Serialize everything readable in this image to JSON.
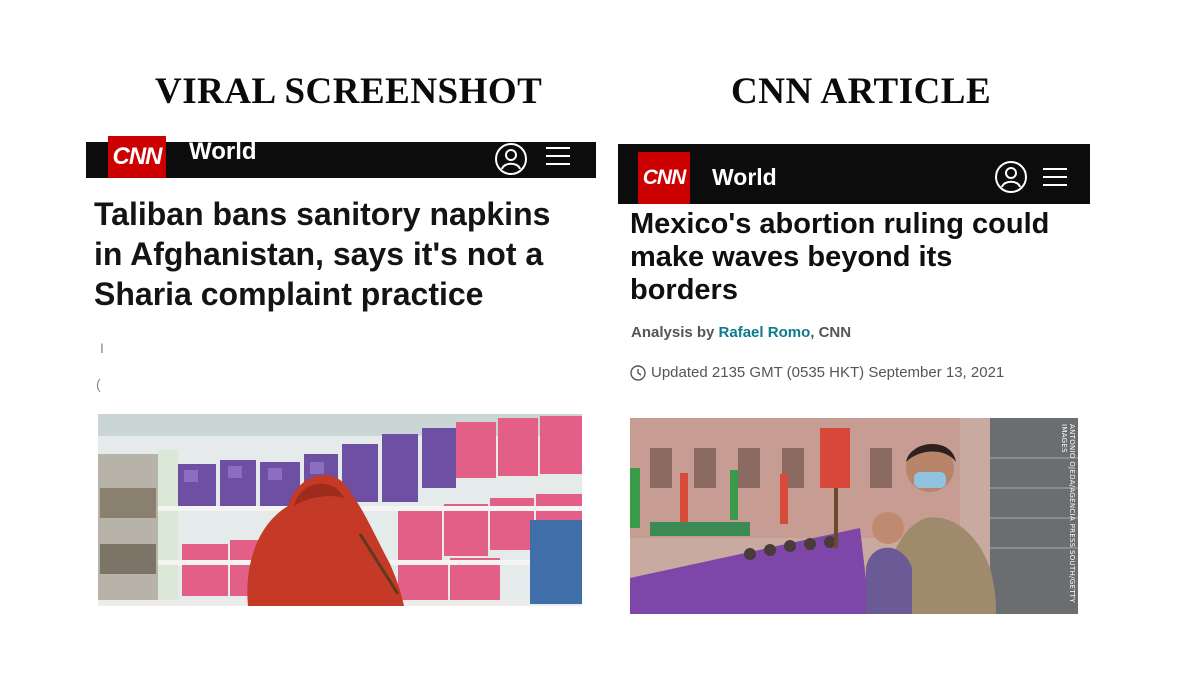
{
  "labels": {
    "left": "VIRAL SCREENSHOT",
    "right": "CNN ARTICLE"
  },
  "viral": {
    "logo": "CNN",
    "section": "World",
    "headline_lines": [
      "Taliban bans sanitory napkins",
      "in Afghanistan, says it's not a",
      "Sharia complaint practice"
    ],
    "fragments": [
      "I",
      "("
    ],
    "photo": "woman-in-hijab-shopping-sanitary-pads"
  },
  "cnn": {
    "logo": "CNN",
    "section": "World",
    "headline_lines": [
      "Mexico's abortion ruling could",
      "make waves beyond its",
      "borders"
    ],
    "byline_prefix": "Analysis by ",
    "author": "Rafael Romo",
    "byline_suffix": ", CNN",
    "updated": "Updated 2135 GMT (0535 HKT) September 13, 2021",
    "photo_credit": "ANTONIO OJEDA/AGENCIA PRESS SOUTH/GETTY IMAGES",
    "photo": "masked-woman-holding-baby-at-protest",
    "colors": {
      "brand_red": "#cc0000",
      "author_link": "#0c7b8e"
    }
  }
}
